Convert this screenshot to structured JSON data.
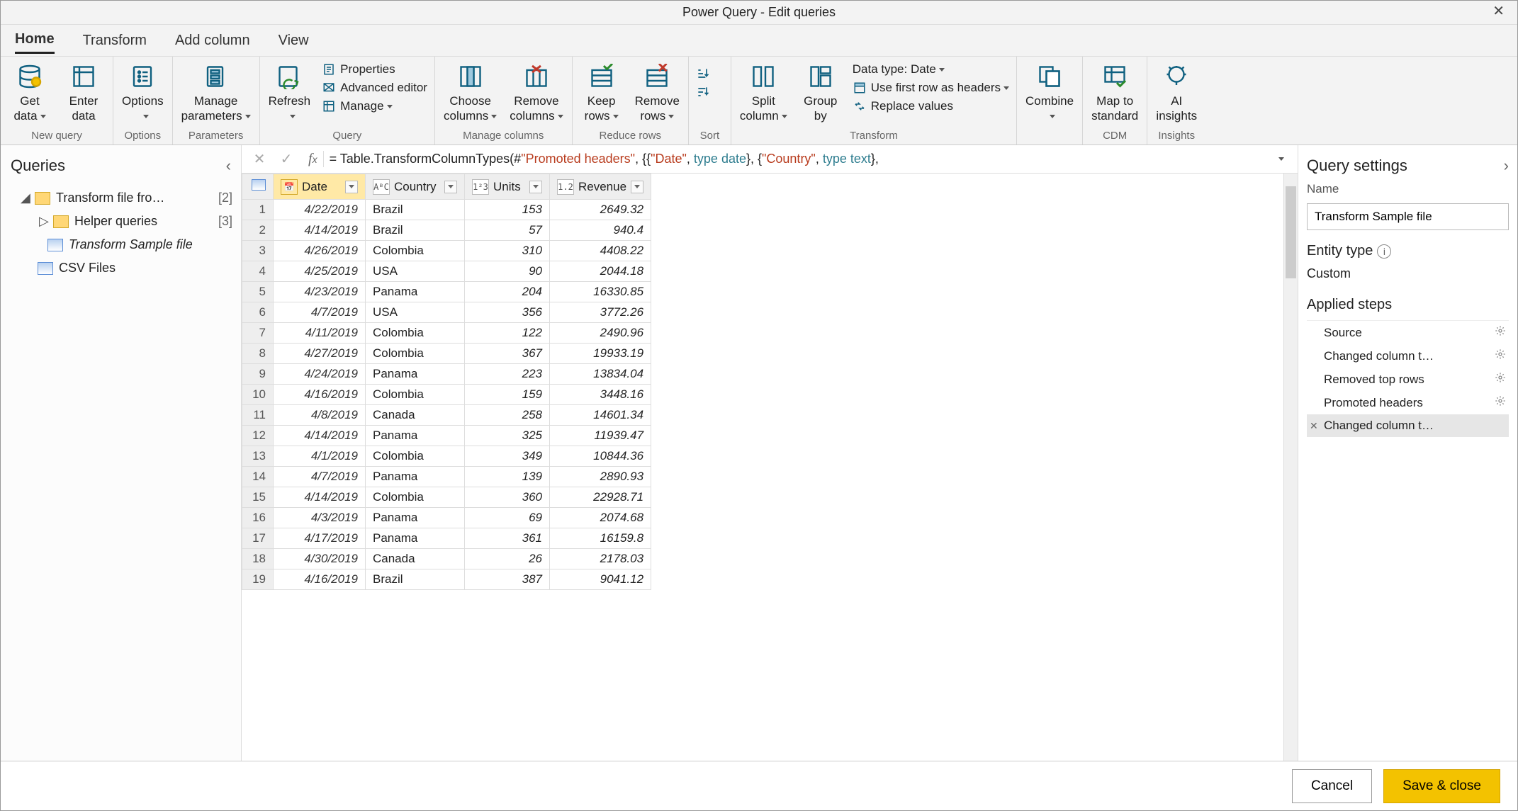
{
  "window": {
    "title": "Power Query - Edit queries"
  },
  "tabs": {
    "home": "Home",
    "transform": "Transform",
    "add_column": "Add column",
    "view": "View"
  },
  "ribbon": {
    "new_query": {
      "caption": "New query",
      "get_data_l1": "Get",
      "get_data_l2": "data",
      "enter_data_l1": "Enter",
      "enter_data_l2": "data"
    },
    "options": {
      "caption": "Options",
      "options_l1": "Options"
    },
    "parameters": {
      "caption": "Parameters",
      "manage_l1": "Manage",
      "manage_l2": "parameters"
    },
    "query": {
      "caption": "Query",
      "refresh_l1": "Refresh",
      "properties": "Properties",
      "advanced_editor": "Advanced editor",
      "manage": "Manage"
    },
    "manage_columns": {
      "caption": "Manage columns",
      "choose_l1": "Choose",
      "choose_l2": "columns",
      "remove_l1": "Remove",
      "remove_l2": "columns"
    },
    "reduce_rows": {
      "caption": "Reduce rows",
      "keep_l1": "Keep",
      "keep_l2": "rows",
      "remove_l1": "Remove",
      "remove_l2": "rows"
    },
    "sort": {
      "caption": "Sort"
    },
    "transform": {
      "caption": "Transform",
      "split_l1": "Split",
      "split_l2": "column",
      "group_l1": "Group",
      "group_l2": "by",
      "data_type": "Data type: Date",
      "use_first_row": "Use first row as headers",
      "replace_values": "Replace values"
    },
    "combine": {
      "caption": "",
      "combine_l1": "Combine"
    },
    "cdm": {
      "caption": "CDM",
      "map_l1": "Map to",
      "map_l2": "standard"
    },
    "insights": {
      "caption": "Insights",
      "ai_l1": "AI",
      "ai_l2": "insights"
    }
  },
  "queries": {
    "heading": "Queries",
    "items": {
      "transform_folder": "Transform file fro…",
      "transform_count": "[2]",
      "helper_folder": "Helper queries",
      "helper_count": "[3]",
      "transform_sample": "Transform Sample file",
      "csv_files": "CSV Files"
    }
  },
  "formula": {
    "prefix": "=   Table.TransformColumnTypes(#",
    "s1": "\"Promoted headers\"",
    "m1": ", {{",
    "s2": "\"Date\"",
    "m2": ", ",
    "k1": "type date",
    "m3": "}, {",
    "s3": "\"Country\"",
    "m4": ", ",
    "k2": "type text",
    "m5": "},"
  },
  "columns": {
    "date": "Date",
    "date_type": "📅",
    "country": "Country",
    "country_type": "AᴮC",
    "units": "Units",
    "units_type": "1²3",
    "revenue": "Revenue",
    "revenue_type": "1.2"
  },
  "rows": [
    {
      "n": "1",
      "date": "4/22/2019",
      "country": "Brazil",
      "units": "153",
      "revenue": "2649.32"
    },
    {
      "n": "2",
      "date": "4/14/2019",
      "country": "Brazil",
      "units": "57",
      "revenue": "940.4"
    },
    {
      "n": "3",
      "date": "4/26/2019",
      "country": "Colombia",
      "units": "310",
      "revenue": "4408.22"
    },
    {
      "n": "4",
      "date": "4/25/2019",
      "country": "USA",
      "units": "90",
      "revenue": "2044.18"
    },
    {
      "n": "5",
      "date": "4/23/2019",
      "country": "Panama",
      "units": "204",
      "revenue": "16330.85"
    },
    {
      "n": "6",
      "date": "4/7/2019",
      "country": "USA",
      "units": "356",
      "revenue": "3772.26"
    },
    {
      "n": "7",
      "date": "4/11/2019",
      "country": "Colombia",
      "units": "122",
      "revenue": "2490.96"
    },
    {
      "n": "8",
      "date": "4/27/2019",
      "country": "Colombia",
      "units": "367",
      "revenue": "19933.19"
    },
    {
      "n": "9",
      "date": "4/24/2019",
      "country": "Panama",
      "units": "223",
      "revenue": "13834.04"
    },
    {
      "n": "10",
      "date": "4/16/2019",
      "country": "Colombia",
      "units": "159",
      "revenue": "3448.16"
    },
    {
      "n": "11",
      "date": "4/8/2019",
      "country": "Canada",
      "units": "258",
      "revenue": "14601.34"
    },
    {
      "n": "12",
      "date": "4/14/2019",
      "country": "Panama",
      "units": "325",
      "revenue": "11939.47"
    },
    {
      "n": "13",
      "date": "4/1/2019",
      "country": "Colombia",
      "units": "349",
      "revenue": "10844.36"
    },
    {
      "n": "14",
      "date": "4/7/2019",
      "country": "Panama",
      "units": "139",
      "revenue": "2890.93"
    },
    {
      "n": "15",
      "date": "4/14/2019",
      "country": "Colombia",
      "units": "360",
      "revenue": "22928.71"
    },
    {
      "n": "16",
      "date": "4/3/2019",
      "country": "Panama",
      "units": "69",
      "revenue": "2074.68"
    },
    {
      "n": "17",
      "date": "4/17/2019",
      "country": "Panama",
      "units": "361",
      "revenue": "16159.8"
    },
    {
      "n": "18",
      "date": "4/30/2019",
      "country": "Canada",
      "units": "26",
      "revenue": "2178.03"
    },
    {
      "n": "19",
      "date": "4/16/2019",
      "country": "Brazil",
      "units": "387",
      "revenue": "9041.12"
    }
  ],
  "settings": {
    "heading": "Query settings",
    "name_label": "Name",
    "name_value": "Transform Sample file",
    "entity_type_label": "Entity type",
    "entity_type_value": "Custom",
    "applied_steps_label": "Applied steps",
    "steps": {
      "source": "Source",
      "changed1": "Changed column t…",
      "removed_top": "Removed top rows",
      "promoted": "Promoted headers",
      "changed2": "Changed column t…"
    }
  },
  "footer": {
    "cancel": "Cancel",
    "save": "Save & close"
  }
}
